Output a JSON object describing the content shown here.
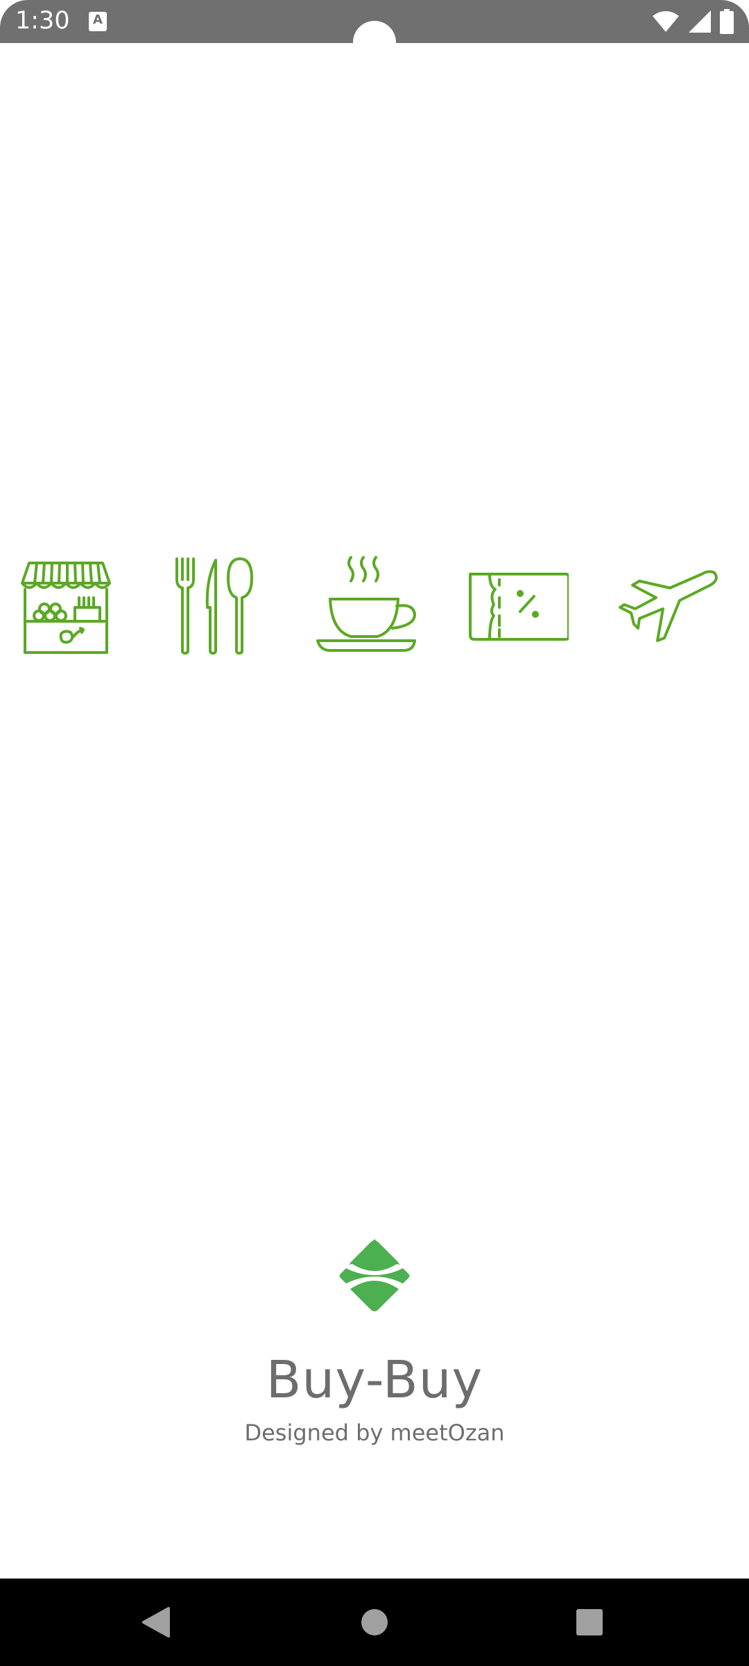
{
  "status_bar": {
    "time": "1:30",
    "notification_glyph": "A",
    "icons": [
      "wifi-icon",
      "signal-icon",
      "battery-icon"
    ]
  },
  "categories": [
    {
      "icon": "market-stall-icon"
    },
    {
      "icon": "cutlery-icon"
    },
    {
      "icon": "coffee-cup-icon"
    },
    {
      "icon": "discount-ticket-icon"
    },
    {
      "icon": "airplane-icon"
    }
  ],
  "brand": {
    "name": "Buy-Buy",
    "credit": "Designed by meetOzan",
    "logo_icon": "brand-logo-icon"
  },
  "colors": {
    "accent": "#5aa923",
    "logo": "#4caf50",
    "text": "#6d6d6d",
    "status_bar": "#707070",
    "nav_bar": "#000000"
  },
  "nav_bar": {
    "buttons": [
      "back-button",
      "home-button",
      "recents-button"
    ]
  }
}
